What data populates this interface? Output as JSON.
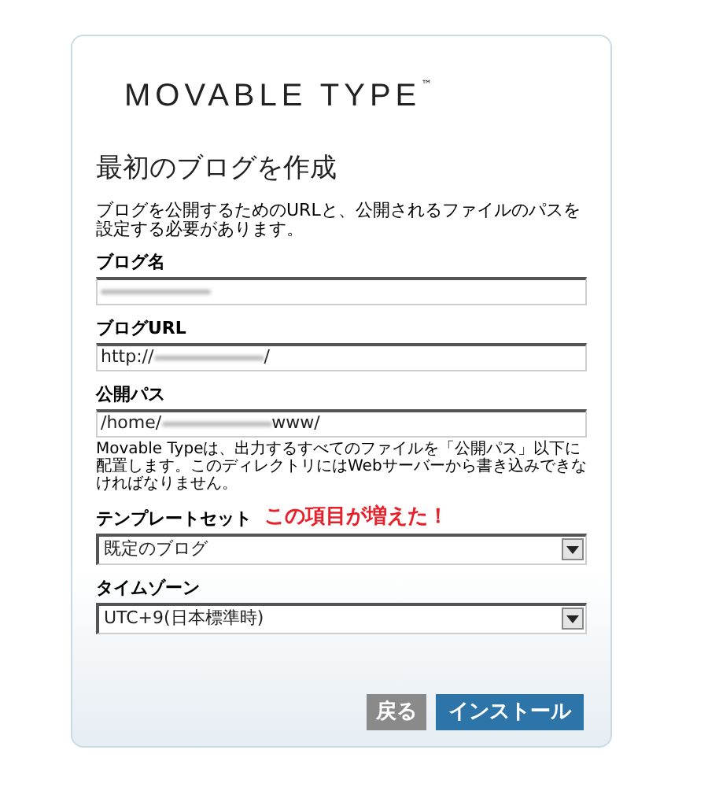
{
  "logo": {
    "text": "MOVABLE TYPE",
    "mark": "™"
  },
  "title": "最初のブログを作成",
  "description": "ブログを公開するためのURLと、公開されるファイルのパスを設定する必要があります。",
  "fields": [
    {
      "kind": "text",
      "label": "ブログ名",
      "redacted": true
    },
    {
      "kind": "text",
      "label": "ブログURL",
      "value_before": "http://",
      "redacted": true,
      "value_after": "/"
    },
    {
      "kind": "text",
      "label": "公開パス",
      "value_before": "/home/",
      "redacted": true,
      "value_after": "www/",
      "help": "Movable Typeは、出力するすべてのファイルを「公開パス」以下に配置します。このディレクトリにはWebサーバーから書き込みできなければなりません。"
    },
    {
      "kind": "select",
      "label": "テンプレートセット",
      "value": "既定のブログ",
      "note": "この項目が増えた！"
    },
    {
      "kind": "select",
      "label": "タイムゾーン",
      "value": "UTC+9(日本標準時)"
    }
  ],
  "buttons": [
    {
      "label": "戻る",
      "kind": "secondary"
    },
    {
      "label": "インストール",
      "kind": "primary"
    }
  ]
}
